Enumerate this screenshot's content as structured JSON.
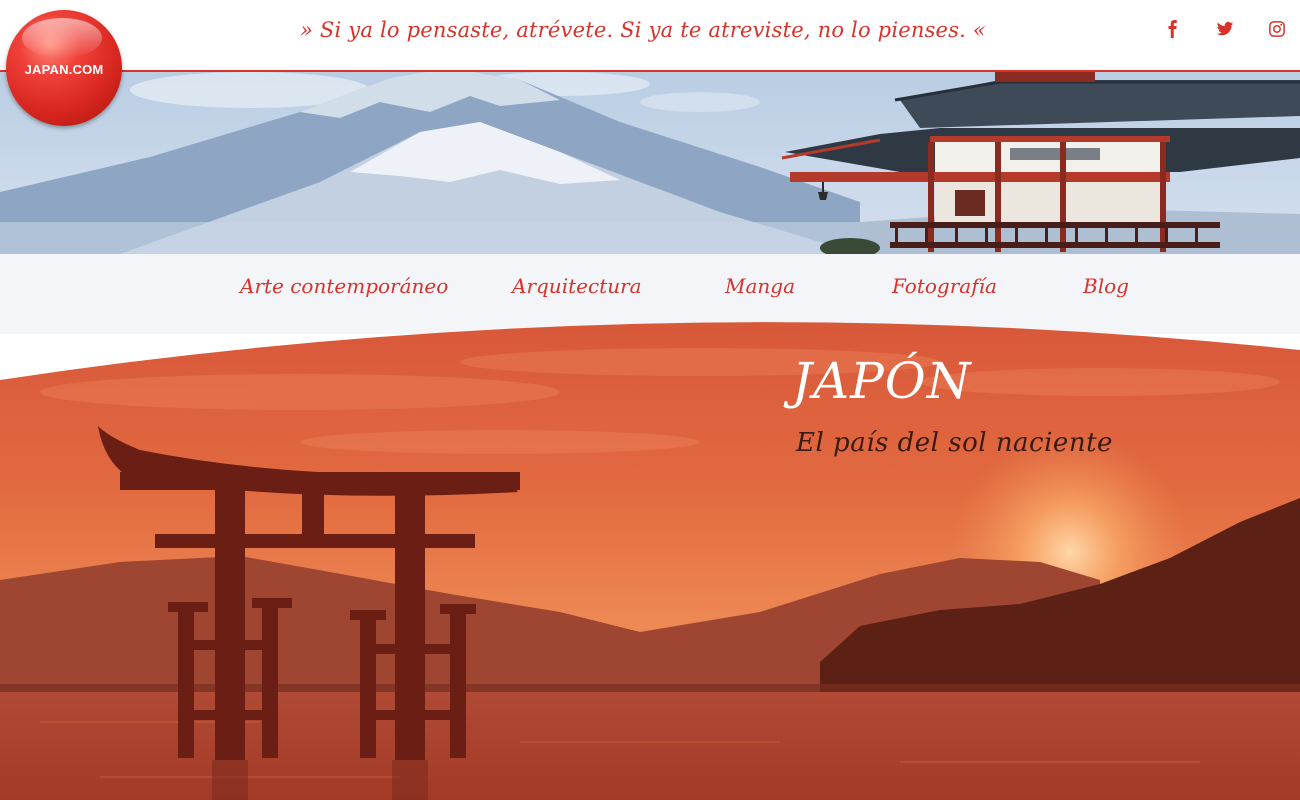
{
  "logo": {
    "text": "JAPAN.COM"
  },
  "header": {
    "tagline": "» Si ya lo pensaste, atrévete. Si ya te atreviste, no lo pienses. «",
    "socials": [
      {
        "name": "facebook",
        "icon": "facebook-icon"
      },
      {
        "name": "twitter",
        "icon": "twitter-icon"
      },
      {
        "name": "instagram",
        "icon": "instagram-icon"
      }
    ]
  },
  "nav": {
    "items": [
      {
        "label": "Arte contemporáneo"
      },
      {
        "label": "Arquitectura"
      },
      {
        "label": "Manga"
      },
      {
        "label": "Fotografía"
      },
      {
        "label": "Blog"
      }
    ]
  },
  "hero": {
    "title": "JAPÓN",
    "subtitle": "El país del sol naciente"
  },
  "colors": {
    "accent": "#d9322a",
    "nav_background": "#f4f5f8",
    "sunset_orange": "#e0653c"
  }
}
